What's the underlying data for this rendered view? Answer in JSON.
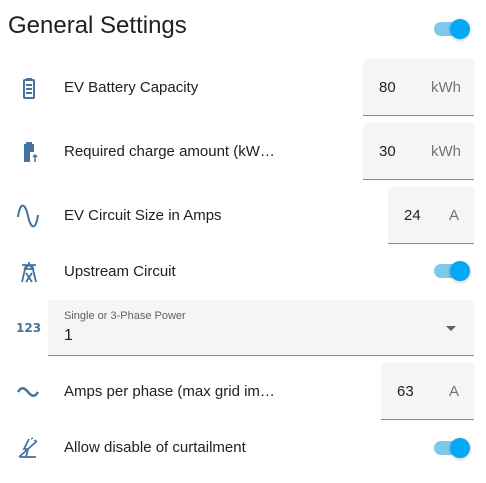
{
  "header": {
    "title": "General Settings",
    "toggle_on": true
  },
  "colors": {
    "accent": "#03a9f4",
    "track": "#7ec9e8",
    "icon": "#44739e"
  },
  "settings": {
    "battery": {
      "label": "EV Battery Capacity",
      "value": "80",
      "unit": "kWh",
      "icon": "battery-icon"
    },
    "charge": {
      "label": "Required charge amount (kW…",
      "value": "30",
      "unit": "kWh",
      "icon": "battery-charging-icon"
    },
    "circuit": {
      "label": "EV Circuit Size in Amps",
      "value": "24",
      "unit": "A",
      "icon": "sine-wave-icon"
    },
    "upstream": {
      "label": "Upstream Circuit",
      "toggle_on": true,
      "icon": "transmission-tower-icon"
    },
    "phase": {
      "floating_label": "Single or 3-Phase Power",
      "value": "1",
      "icon": "numeric-123-icon"
    },
    "amps": {
      "label": "Amps per phase (max grid im…",
      "value": "63",
      "unit": "A",
      "icon": "current-ac-icon"
    },
    "curtail": {
      "label": "Allow disable of curtailment",
      "toggle_on": true,
      "icon": "flash-off-icon"
    }
  }
}
